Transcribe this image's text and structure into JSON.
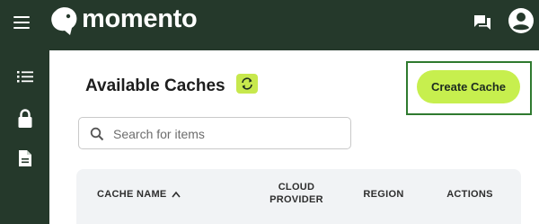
{
  "header": {
    "brand": "momento",
    "icons": {
      "menu": "hamburger-menu-icon",
      "logo": "momento-logo-icon",
      "chat": "chat-bubbles-icon",
      "account": "account-circle-icon"
    }
  },
  "sidebar": {
    "items": [
      {
        "name": "list",
        "icon": "list-icon"
      },
      {
        "name": "lock",
        "icon": "lock-icon"
      },
      {
        "name": "document",
        "icon": "document-icon"
      }
    ]
  },
  "page": {
    "title": "Available Caches",
    "refresh_icon": "refresh-icon"
  },
  "actions": {
    "create_label": "Create Cache"
  },
  "search": {
    "placeholder": "Search for items",
    "value": ""
  },
  "table": {
    "columns": [
      {
        "label": "CACHE NAME",
        "sort": "ascending"
      },
      {
        "label": "CLOUD\nPROVIDER"
      },
      {
        "label": "REGION"
      },
      {
        "label": "ACTIONS"
      }
    ]
  },
  "colors": {
    "nav_bg": "#25392b",
    "accent": "#c7ef4e",
    "highlight_border": "#2f7a2f"
  }
}
